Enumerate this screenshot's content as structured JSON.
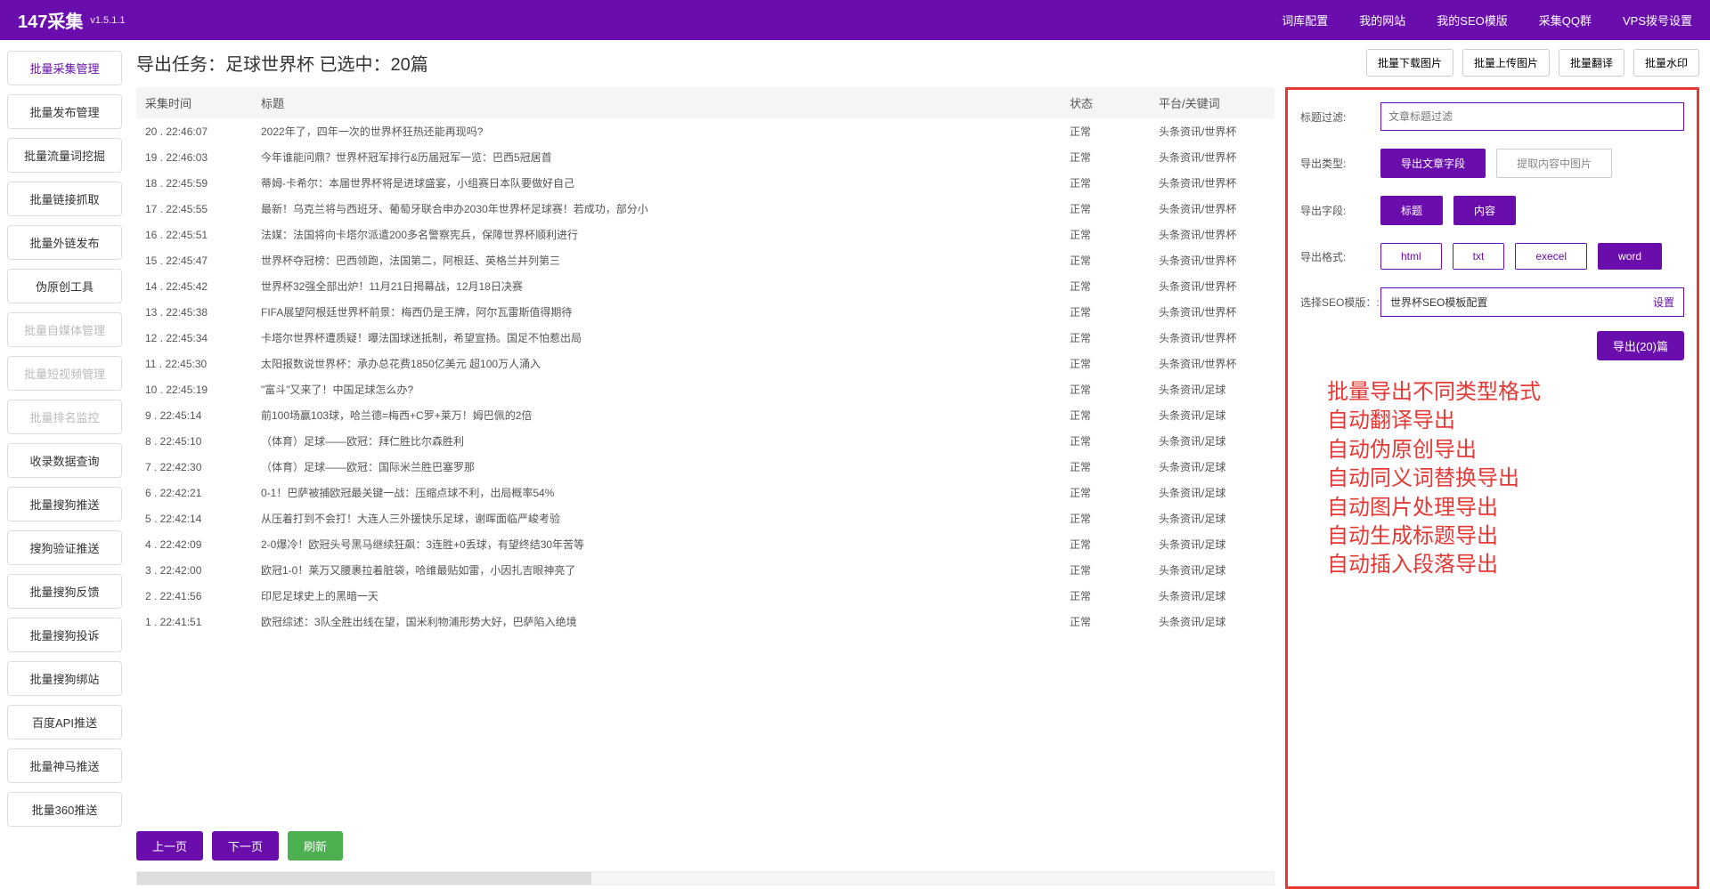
{
  "header": {
    "brand": "147采集",
    "version": "v1.5.1.1",
    "nav": [
      "词库配置",
      "我的网站",
      "我的SEO模版",
      "采集QQ群",
      "VPS拨号设置"
    ]
  },
  "sidebar": {
    "items": [
      {
        "label": "批量采集管理",
        "state": "active"
      },
      {
        "label": "批量发布管理",
        "state": ""
      },
      {
        "label": "批量流量词挖掘",
        "state": ""
      },
      {
        "label": "批量链接抓取",
        "state": ""
      },
      {
        "label": "批量外链发布",
        "state": ""
      },
      {
        "label": "伪原创工具",
        "state": ""
      },
      {
        "label": "批量自媒体管理",
        "state": "disabled"
      },
      {
        "label": "批量短视频管理",
        "state": "disabled"
      },
      {
        "label": "批量排名监控",
        "state": "disabled"
      },
      {
        "label": "收录数据查询",
        "state": ""
      },
      {
        "label": "批量搜狗推送",
        "state": ""
      },
      {
        "label": "搜狗验证推送",
        "state": ""
      },
      {
        "label": "批量搜狗反馈",
        "state": ""
      },
      {
        "label": "批量搜狗投诉",
        "state": ""
      },
      {
        "label": "批量搜狗绑站",
        "state": ""
      },
      {
        "label": "百度API推送",
        "state": ""
      },
      {
        "label": "批量神马推送",
        "state": ""
      },
      {
        "label": "批量360推送",
        "state": ""
      }
    ]
  },
  "main": {
    "title": "导出任务：足球世界杯 已选中：20篇",
    "topButtons": [
      "批量下载图片",
      "批量上传图片",
      "批量翻译",
      "批量水印"
    ],
    "columns": [
      "采集时间",
      "标题",
      "状态",
      "平台/关键词"
    ],
    "rows": [
      {
        "idx": "20",
        "time": "22:46:07",
        "title": "2022年了，四年一次的世界杯狂热还能再现吗?",
        "status": "正常",
        "src": "头条资讯/世界杯"
      },
      {
        "idx": "19",
        "time": "22:46:03",
        "title": "今年谁能问鼎？世界杯冠军排行&历届冠军一览：巴西5冠居首",
        "status": "正常",
        "src": "头条资讯/世界杯"
      },
      {
        "idx": "18",
        "time": "22:45:59",
        "title": "蒂姆-卡希尔：本届世界杯将是进球盛宴，小组赛日本队要做好自己",
        "status": "正常",
        "src": "头条资讯/世界杯"
      },
      {
        "idx": "17",
        "time": "22:45:55",
        "title": "最新！乌克兰将与西班牙、葡萄牙联合申办2030年世界杯足球赛！若成功，部分小",
        "status": "正常",
        "src": "头条资讯/世界杯"
      },
      {
        "idx": "16",
        "time": "22:45:51",
        "title": "法媒：法国将向卡塔尔派遣200多名警察宪兵，保障世界杯顺利进行",
        "status": "正常",
        "src": "头条资讯/世界杯"
      },
      {
        "idx": "15",
        "time": "22:45:47",
        "title": "世界杯夺冠榜：巴西领跑，法国第二，阿根廷、英格兰并列第三",
        "status": "正常",
        "src": "头条资讯/世界杯"
      },
      {
        "idx": "14",
        "time": "22:45:42",
        "title": "世界杯32强全部出炉！11月21日揭幕战，12月18日决赛",
        "status": "正常",
        "src": "头条资讯/世界杯"
      },
      {
        "idx": "13",
        "time": "22:45:38",
        "title": "FIFA展望阿根廷世界杯前景：梅西仍是王牌，阿尔瓦雷斯值得期待",
        "status": "正常",
        "src": "头条资讯/世界杯"
      },
      {
        "idx": "12",
        "time": "22:45:34",
        "title": "卡塔尔世界杯遭质疑！曝法国球迷抵制，希望宣扬。国足不怕惹出局",
        "status": "正常",
        "src": "头条资讯/世界杯"
      },
      {
        "idx": "11",
        "time": "22:45:30",
        "title": "太阳报数说世界杯：承办总花费1850亿美元 超100万人涌入",
        "status": "正常",
        "src": "头条资讯/世界杯"
      },
      {
        "idx": "10",
        "time": "22:45:19",
        "title": "\"富斗\"又来了！中国足球怎么办?",
        "status": "正常",
        "src": "头条资讯/足球"
      },
      {
        "idx": "9",
        "time": "22:45:14",
        "title": "前100场赢103球，哈兰德=梅西+C罗+莱万！姆巴佩的2倍",
        "status": "正常",
        "src": "头条资讯/足球"
      },
      {
        "idx": "8",
        "time": "22:45:10",
        "title": "（体育）足球——欧冠：拜仁胜比尔森胜利",
        "status": "正常",
        "src": "头条资讯/足球"
      },
      {
        "idx": "7",
        "time": "22:42:30",
        "title": "（体育）足球——欧冠：国际米兰胜巴塞罗那",
        "status": "正常",
        "src": "头条资讯/足球"
      },
      {
        "idx": "6",
        "time": "22:42:21",
        "title": "0-1！巴萨被捕欧冠最关键一战：压缩点球不利，出局概率54%",
        "status": "正常",
        "src": "头条资讯/足球"
      },
      {
        "idx": "5",
        "time": "22:42:14",
        "title": "从压着打到不会打！大连人三外援快乐足球，谢晖面临严峻考验",
        "status": "正常",
        "src": "头条资讯/足球"
      },
      {
        "idx": "4",
        "time": "22:42:09",
        "title": "2-0爆冷！欧冠头号黑马继续狂飙：3连胜+0丢球，有望终结30年苦等",
        "status": "正常",
        "src": "头条资讯/足球"
      },
      {
        "idx": "3",
        "time": "22:42:00",
        "title": "欧冠1-0！莱万又腰裹拉着脏袋，哈维最贴如雷，小因扎吉眼神亮了",
        "status": "正常",
        "src": "头条资讯/足球"
      },
      {
        "idx": "2",
        "time": "22:41:56",
        "title": "印尼足球史上的黑暗一天",
        "status": "正常",
        "src": "头条资讯/足球"
      },
      {
        "idx": "1",
        "time": "22:41:51",
        "title": "欧冠综述：3队全胜出线在望，国米利物浦形势大好，巴萨陷入绝境",
        "status": "正常",
        "src": "头条资讯/足球"
      }
    ],
    "pager": {
      "prev": "上一页",
      "next": "下一页",
      "refresh": "刷新"
    }
  },
  "panel": {
    "labels": {
      "titleFilter": "标题过滤:",
      "exportType": "导出类型:",
      "exportFields": "导出字段:",
      "exportFormat": "导出格式:",
      "seoTemplate": "选择SEO模版：:"
    },
    "titleFilterPlaceholder": "文章标题过滤",
    "exportTypes": {
      "fields": "导出文章字段",
      "images": "提取内容中图片"
    },
    "exportFields": {
      "title": "标题",
      "content": "内容"
    },
    "formats": {
      "html": "html",
      "txt": "txt",
      "excel": "execel",
      "word": "word"
    },
    "seoValue": "世界杯SEO模板配置",
    "seoSetting": "设置",
    "exportBtn": "导出(20)篇",
    "features": [
      "批量导出不同类型格式",
      "自动翻译导出",
      "自动伪原创导出",
      "自动同义词替换导出",
      "自动图片处理导出",
      "自动生成标题导出",
      "自动插入段落导出"
    ]
  }
}
